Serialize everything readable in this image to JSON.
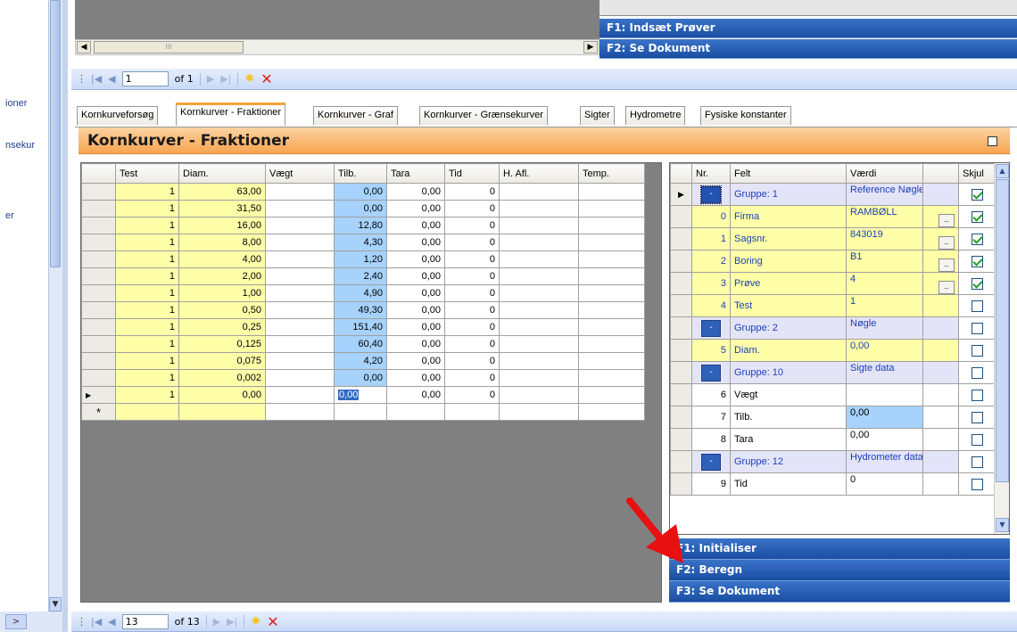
{
  "left_panel": {
    "items": [
      "ioner",
      "nsekur",
      "er"
    ]
  },
  "top": {
    "hscroll_thumb": "III",
    "actions": [
      {
        "label": "F1: Indsæt Prøver"
      },
      {
        "label": "F2: Se Dokument"
      }
    ]
  },
  "nav_top": {
    "position": "1",
    "of_label": "of 1"
  },
  "tabs": [
    {
      "label": "Kornkurveforsøg"
    },
    {
      "label": "Kornkurver - Fraktioner"
    },
    {
      "label": "Kornkurver - Graf"
    },
    {
      "label": "Kornkurver - Grænsekurver"
    },
    {
      "label": "Sigter"
    },
    {
      "label": "Hydrometre"
    },
    {
      "label": "Fysiske konstanter"
    }
  ],
  "panel": {
    "title": "Kornkurver - Fraktioner"
  },
  "fractions_grid": {
    "columns": [
      "Test",
      "Diam.",
      "Vægt",
      "Tilb.",
      "Tara",
      "Tid",
      "H. Afl.",
      "Temp."
    ],
    "rows": [
      [
        "1",
        "63,00",
        "",
        "0,00",
        "0,00",
        "0"
      ],
      [
        "1",
        "31,50",
        "",
        "0,00",
        "0,00",
        "0"
      ],
      [
        "1",
        "16,00",
        "",
        "12,80",
        "0,00",
        "0"
      ],
      [
        "1",
        "8,00",
        "",
        "4,30",
        "0,00",
        "0"
      ],
      [
        "1",
        "4,00",
        "",
        "1,20",
        "0,00",
        "0"
      ],
      [
        "1",
        "2,00",
        "",
        "2,40",
        "0,00",
        "0"
      ],
      [
        "1",
        "1,00",
        "",
        "4,90",
        "0,00",
        "0"
      ],
      [
        "1",
        "0,50",
        "",
        "49,30",
        "0,00",
        "0"
      ],
      [
        "1",
        "0,25",
        "",
        "151,40",
        "0,00",
        "0"
      ],
      [
        "1",
        "0,125",
        "",
        "60,40",
        "0,00",
        "0"
      ],
      [
        "1",
        "0,075",
        "",
        "4,20",
        "0,00",
        "0"
      ],
      [
        "1",
        "0,002",
        "",
        "0,00",
        "0,00",
        "0"
      ],
      [
        "1",
        "0,00",
        "",
        "0,00",
        "0,00",
        "0"
      ]
    ],
    "new_row_marker": "*"
  },
  "props_grid": {
    "columns": [
      "Nr.",
      "Felt",
      "Værdi",
      "",
      "Skjul"
    ],
    "rows": [
      {
        "kind": "group",
        "felt": "Gruppe: 1",
        "vaerdi": "Reference Nøgle",
        "checked": true
      },
      {
        "kind": "field",
        "nr": "0",
        "felt": "Firma",
        "vaerdi": "RAMBØLL",
        "dots": true,
        "checked": true
      },
      {
        "kind": "field",
        "nr": "1",
        "felt": "Sagsnr.",
        "vaerdi": "843019",
        "dots": true,
        "checked": true
      },
      {
        "kind": "field",
        "nr": "2",
        "felt": "Boring",
        "vaerdi": "B1",
        "dots": true,
        "checked": true
      },
      {
        "kind": "field",
        "nr": "3",
        "felt": "Prøve",
        "vaerdi": "4",
        "dots": true,
        "checked": true
      },
      {
        "kind": "field",
        "nr": "4",
        "felt": "Test",
        "vaerdi": "1",
        "checked": false
      },
      {
        "kind": "group",
        "felt": "Gruppe: 2",
        "vaerdi": "Nøgle",
        "checked": false
      },
      {
        "kind": "field",
        "nr": "5",
        "felt": "Diam.",
        "vaerdi": "0,00",
        "checked": false
      },
      {
        "kind": "group",
        "felt": "Gruppe: 10",
        "vaerdi": "Sigte data",
        "checked": false
      },
      {
        "kind": "plain",
        "nr": "6",
        "felt": "Vægt",
        "vaerdi": "",
        "checked": false
      },
      {
        "kind": "plain",
        "nr": "7",
        "felt": "Tilb.",
        "vaerdi": "0,00",
        "bluevalue": true,
        "checked": false
      },
      {
        "kind": "plain",
        "nr": "8",
        "felt": "Tara",
        "vaerdi": "0,00",
        "checked": false
      },
      {
        "kind": "group",
        "felt": "Gruppe: 12",
        "vaerdi": "Hydrometer data",
        "checked": false
      },
      {
        "kind": "plain",
        "nr": "9",
        "felt": "Tid",
        "vaerdi": "0",
        "checked": false
      }
    ]
  },
  "actions": [
    {
      "label": "F1: Initialiser"
    },
    {
      "label": "F2: Beregn"
    },
    {
      "label": "F3: Se Dokument"
    }
  ],
  "nav_bottom": {
    "position": "13",
    "of_label": "of 13"
  },
  "colors": {
    "panel_header": "#f7a450",
    "action_bar": "#1a4ea3",
    "yellow_cell": "#ffffa8",
    "blue_cell": "#a6d2fb",
    "arrow": "#e81010"
  }
}
